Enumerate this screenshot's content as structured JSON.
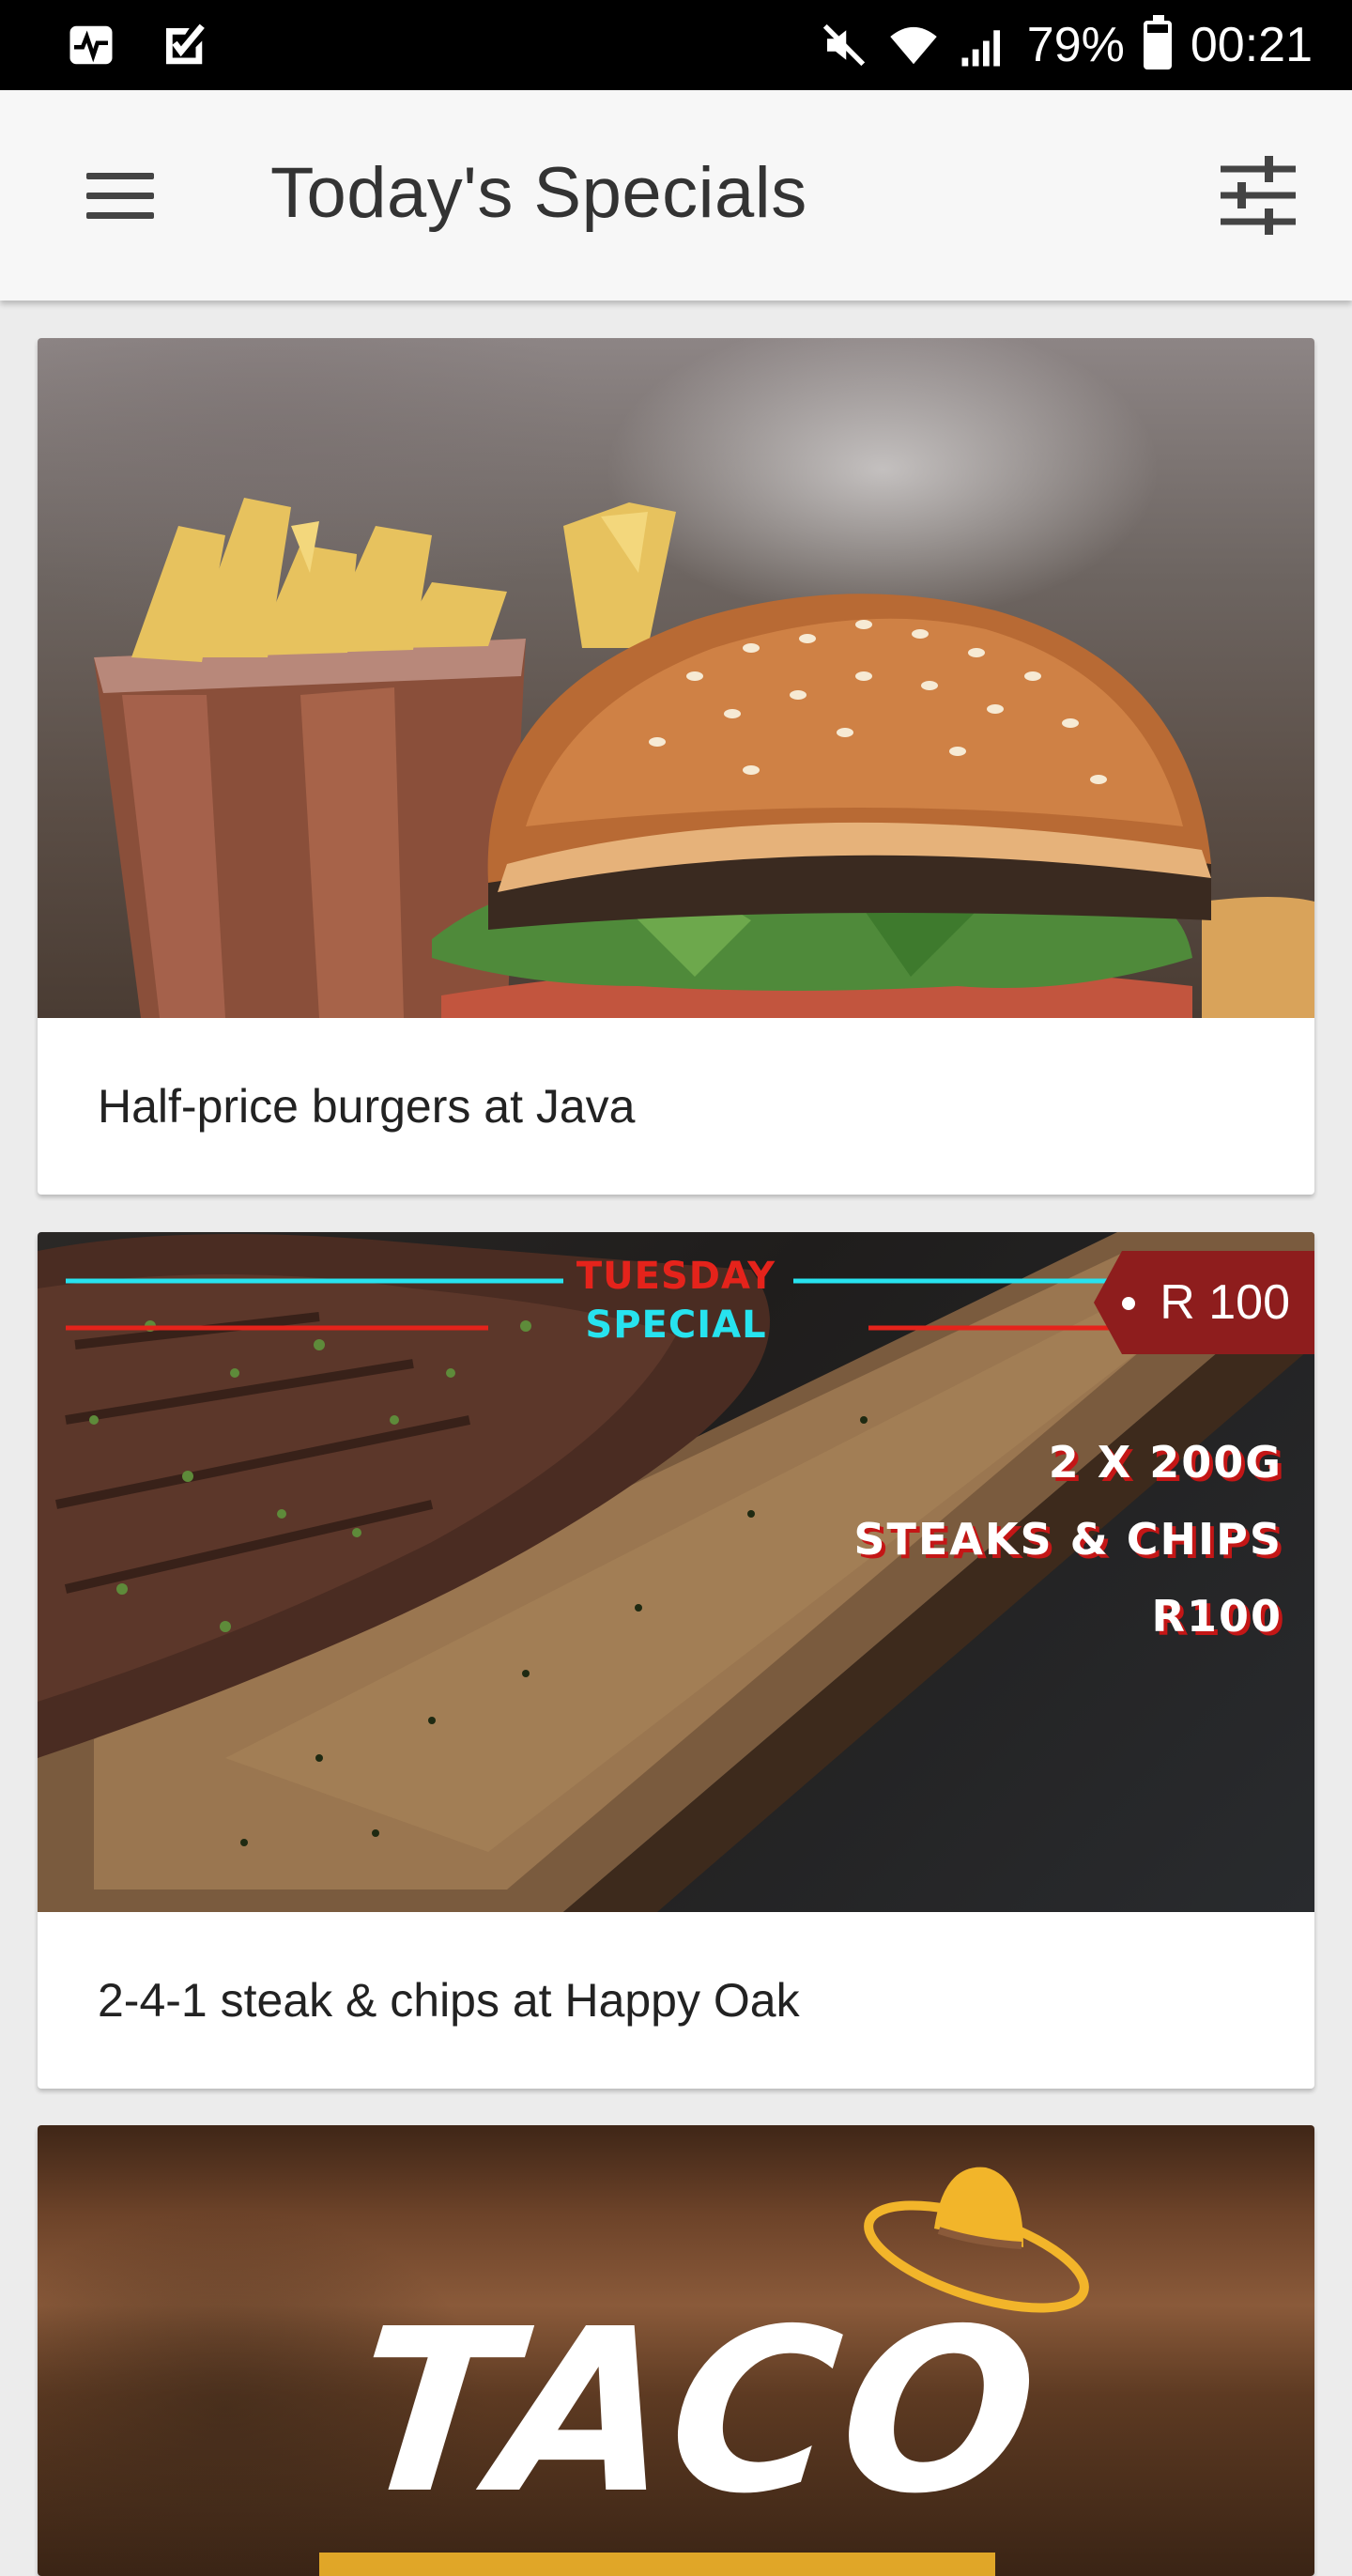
{
  "status_bar": {
    "left_icons": [
      "activity-icon",
      "tasks-check-icon"
    ],
    "right_icons": [
      "mute-icon",
      "wifi-icon",
      "signal-icon",
      "battery-icon"
    ],
    "battery_percent": "79%",
    "time": "00:21"
  },
  "app_bar": {
    "title": "Today's Specials",
    "menu_icon": "hamburger-menu-icon",
    "filter_icon": "sliders-filter-icon"
  },
  "cards": [
    {
      "caption": "Half-price burgers at Java",
      "image": "burger-and-fries-photo"
    },
    {
      "caption": "2-4-1 steak & chips at Happy Oak",
      "image": "steak-on-board-photo",
      "price_tag": "R 100",
      "poster_title_1": "TUESDAY",
      "poster_title_2": "SPECIAL",
      "poster_lines": [
        "2 X 200G",
        "STEAKS & CHIPS",
        "R100"
      ]
    },
    {
      "image": "taco-poster-photo",
      "poster_title": "TACO"
    }
  ],
  "colors": {
    "status_bar_bg": "#000000",
    "app_bar_bg": "#f7f7f7",
    "title_text": "#333333",
    "price_tag_bg": "#8e1d1d",
    "poster_red": "#e5231b",
    "poster_cyan": "#27e3ef",
    "taco_yellow": "#f2b52a"
  }
}
